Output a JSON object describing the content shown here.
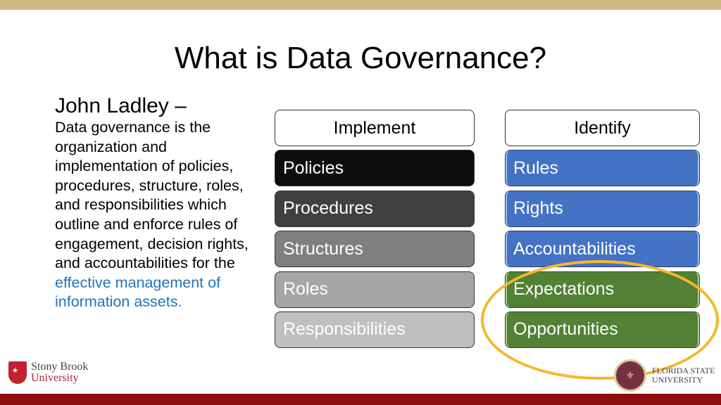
{
  "title": "What is Data Governance?",
  "definition": {
    "author": "John Ladley –",
    "text": "Data governance is the organization and implementation of policies, procedures, structure, roles, and responsibilities which outline and enforce rules of engagement, decision rights, and accountabilities for the",
    "highlight": "effective management of information assets.",
    "highlight_color": "#1f74c0"
  },
  "implement": {
    "header": "Implement",
    "items": [
      "Policies",
      "Procedures",
      "Structures",
      "Roles",
      "Responsibilities"
    ],
    "colors": [
      "#0d0d0d",
      "#3f3f3f",
      "#7f7f7f",
      "#a6a6a6",
      "#bfbfbf"
    ]
  },
  "identify": {
    "header": "Identify",
    "items": [
      "Rules",
      "Rights",
      "Accountabilities",
      "Expectations",
      "Opportunities"
    ],
    "highlighted": [
      "Expectations",
      "Opportunities"
    ]
  },
  "logos": {
    "left": {
      "line1": "Stony Brook",
      "line2": "University"
    },
    "right": {
      "line1": "FLORIDA STATE",
      "line2": "UNIVERSITY"
    }
  },
  "colors": {
    "top_band": "#cfb784",
    "bottom_band": "#8e0d0d",
    "blue": "#4472c4",
    "green": "#538135",
    "circle": "#f5b82a"
  }
}
